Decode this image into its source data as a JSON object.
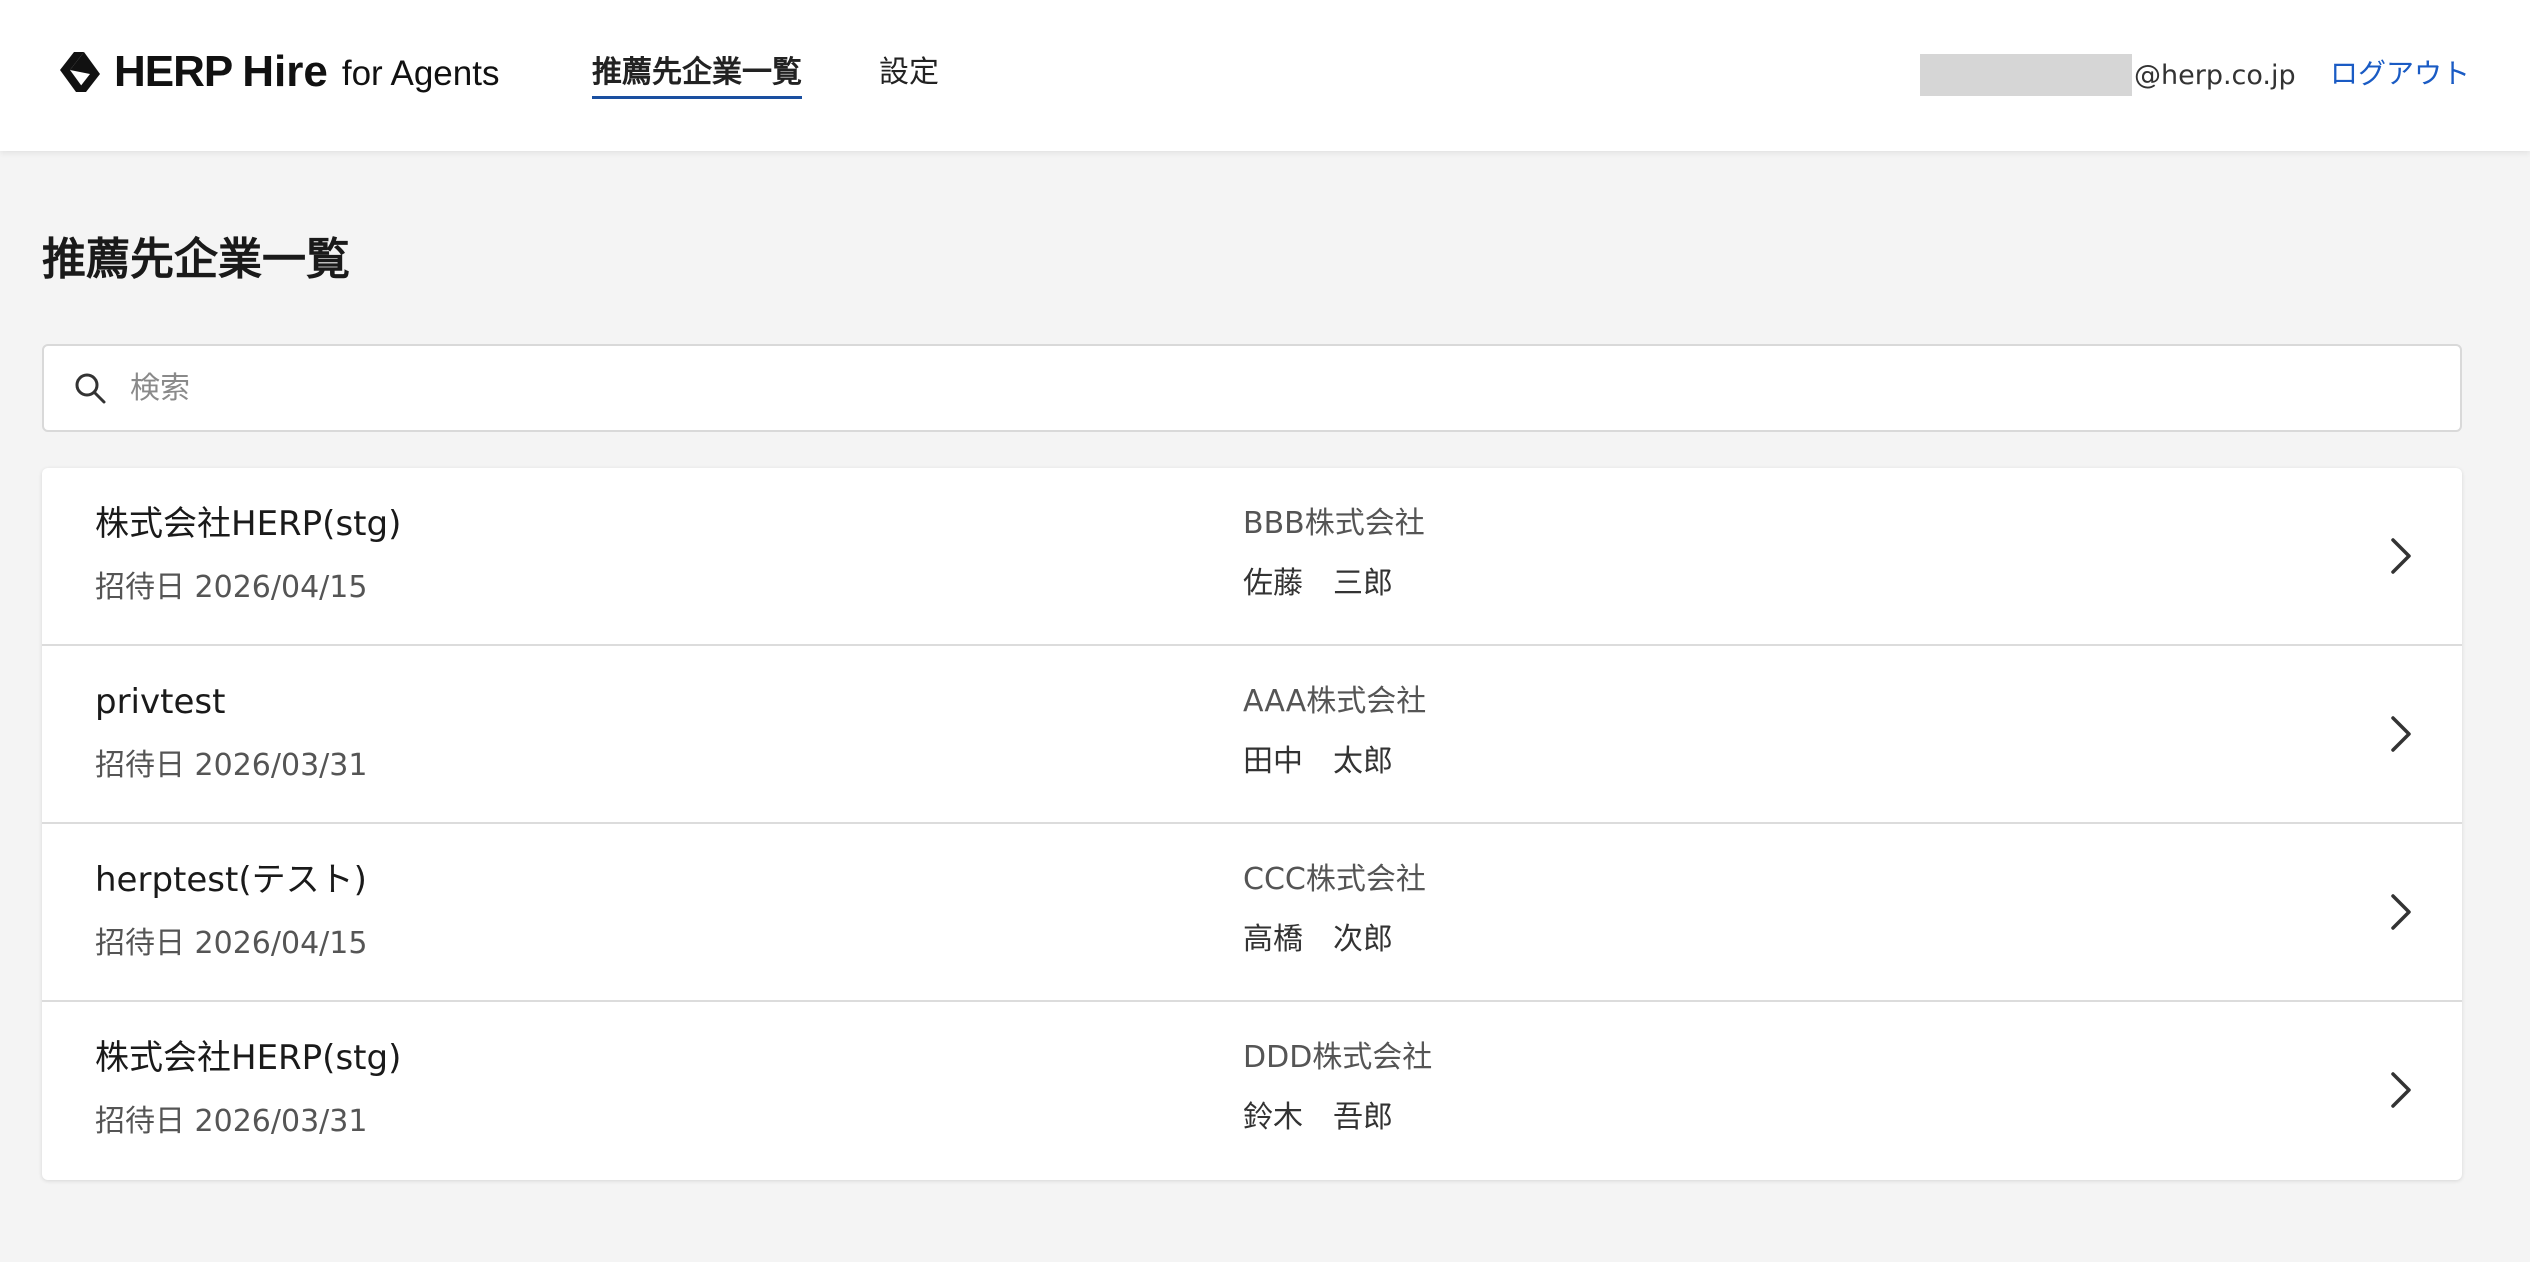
{
  "header": {
    "logo": {
      "herp": "HERP",
      "hire": "Hire",
      "agents": "for Agents"
    },
    "nav": [
      {
        "label": "推薦先企業一覧",
        "active": true
      },
      {
        "label": "設定",
        "active": false
      }
    ],
    "user_email_domain": "@herp.co.jp",
    "logout_label": "ログアウト"
  },
  "page": {
    "title": "推薦先企業一覧"
  },
  "search": {
    "placeholder": "検索",
    "value": ""
  },
  "companies": [
    {
      "name": "株式会社HERP(stg)",
      "invited": "招待日 2026/04/15",
      "agency": "BBB株式会社",
      "contact": "佐藤　三郎"
    },
    {
      "name": "privtest",
      "invited": "招待日 2026/03/31",
      "agency": "AAA株式会社",
      "contact": "田中　太郎"
    },
    {
      "name": "herptest(テスト)",
      "invited": "招待日 2026/04/15",
      "agency": "CCC株式会社",
      "contact": "高橋　次郎"
    },
    {
      "name": "株式会社HERP(stg)",
      "invited": "招待日 2026/03/31",
      "agency": "DDD株式会社",
      "contact": "鈴木　吾郎"
    }
  ],
  "colors": {
    "accent": "#1a5bc4",
    "nav_underline": "#1a4fa0",
    "background": "#f4f4f4"
  },
  "icons": {
    "logo": "herp-logo-icon",
    "search": "search-icon",
    "row_arrow": "chevron-right-icon"
  }
}
